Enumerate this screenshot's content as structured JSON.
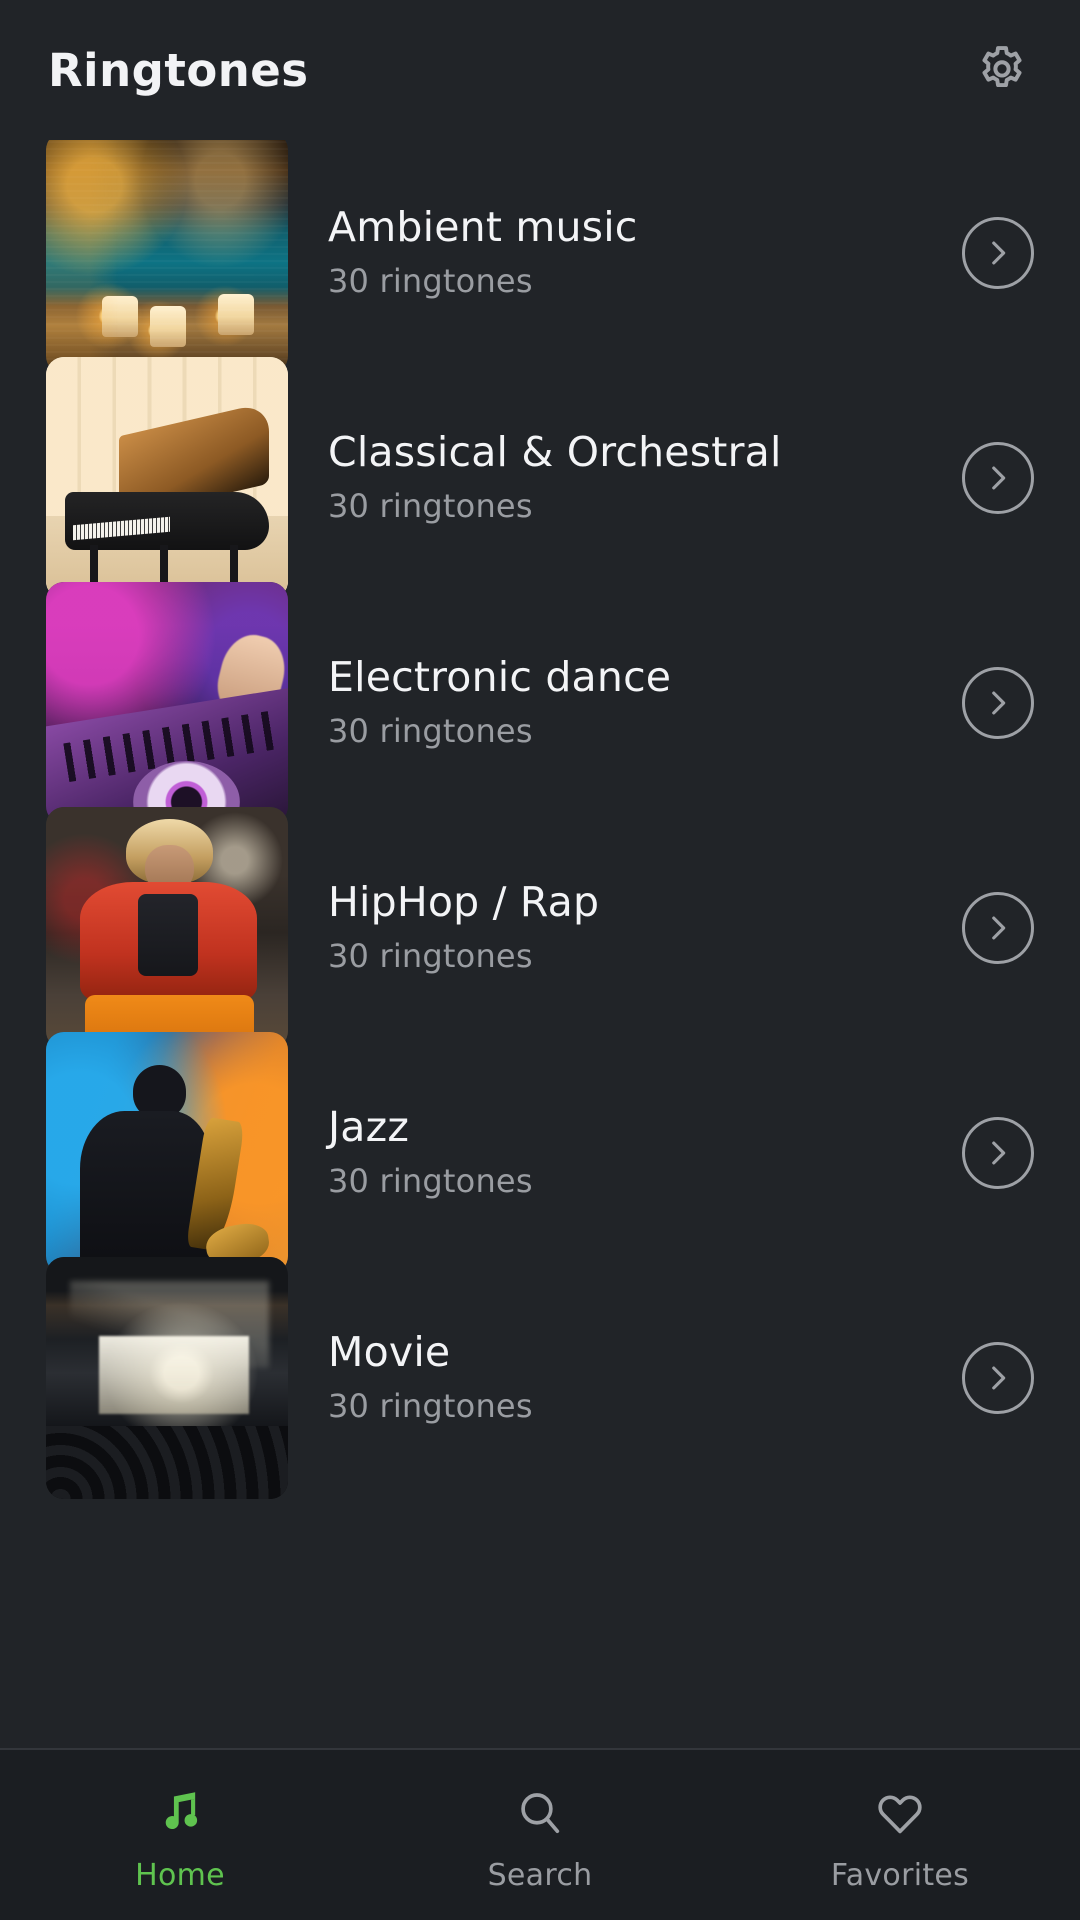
{
  "header": {
    "title": "Ringtones",
    "settings_icon": "gear-icon"
  },
  "colors": {
    "background": "#212428",
    "nav_background": "#1B1E22",
    "accent_green": "#5FC34F",
    "title_text": "#F2F3F5",
    "subtitle_text": "#9A9DA2",
    "icon_outline": "#9EA1A6",
    "divider": "#33363B"
  },
  "list": {
    "items": [
      {
        "title": "Ambient music",
        "subtitle": "30 ringtones",
        "thumbnail": "candles-by-pool-at-night",
        "chevron_icon": "chevron-right-icon"
      },
      {
        "title": "Classical & Orchestral",
        "subtitle": "30 ringtones",
        "thumbnail": "grand-piano-in-sunlit-room",
        "chevron_icon": "chevron-right-icon"
      },
      {
        "title": "Electronic dance",
        "subtitle": "30 ringtones",
        "thumbnail": "dj-mixer-magenta-lighting",
        "chevron_icon": "chevron-right-icon"
      },
      {
        "title": "HipHop / Rap",
        "subtitle": "30 ringtones",
        "thumbnail": "person-red-jacket-street",
        "chevron_icon": "chevron-right-icon"
      },
      {
        "title": "Jazz",
        "subtitle": "30 ringtones",
        "thumbnail": "saxophonist-stage-lights",
        "chevron_icon": "chevron-right-icon"
      },
      {
        "title": "Movie",
        "subtitle": "30 ringtones",
        "thumbnail": "cinema-auditorium-screen",
        "chevron_icon": "chevron-right-icon"
      }
    ]
  },
  "bottom_nav": {
    "items": [
      {
        "label": "Home",
        "icon": "music-note-icon",
        "active": true
      },
      {
        "label": "Search",
        "icon": "search-icon",
        "active": false
      },
      {
        "label": "Favorites",
        "icon": "heart-icon",
        "active": false
      }
    ]
  }
}
